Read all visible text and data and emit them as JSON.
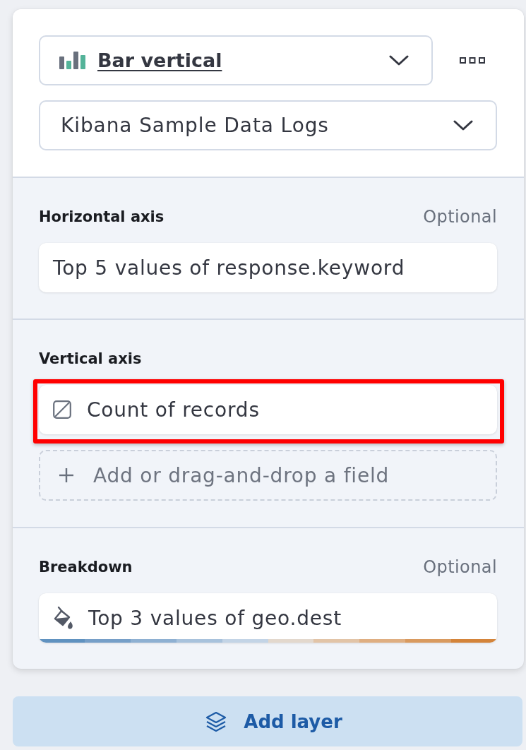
{
  "layer_header": {
    "chart_type": {
      "label": "Bar vertical"
    },
    "data_view": {
      "label": "Kibana Sample Data Logs"
    }
  },
  "sections": [
    {
      "title": "Horizontal axis",
      "hint": "Optional",
      "items": [
        {
          "kind": "dimension",
          "label": "Top 5 values of response.keyword",
          "highlighted": false
        }
      ]
    },
    {
      "title": "Vertical axis",
      "items": [
        {
          "kind": "count",
          "label": "Count of records",
          "highlighted": true
        },
        {
          "kind": "add",
          "label": "Add or drag-and-drop a field",
          "highlighted": false
        }
      ]
    },
    {
      "title": "Breakdown",
      "hint": "Optional",
      "items": [
        {
          "kind": "breakdown",
          "label": "Top 3 values of geo.dest",
          "highlighted": false,
          "palette": [
            {
              "color": "#6092c0"
            },
            {
              "color": "#769fc8"
            },
            {
              "color": "#8eb0d2"
            },
            {
              "color": "#a8c2dc"
            },
            {
              "color": "#c3d4e6"
            },
            {
              "color": "#e3d8cd"
            },
            {
              "color": "#e2c4a7"
            },
            {
              "color": "#dfae81"
            },
            {
              "color": "#d99a5f"
            },
            {
              "color": "#d4843a"
            }
          ]
        }
      ]
    }
  ],
  "add_layer_button": {
    "label": "Add layer"
  }
}
